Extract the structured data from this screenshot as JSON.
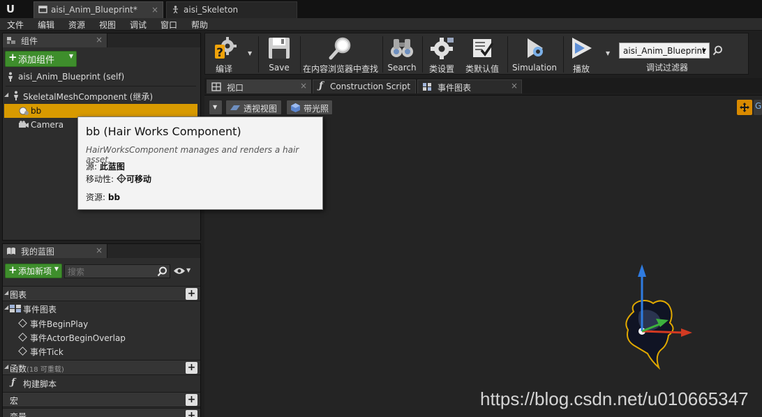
{
  "titlebar": {
    "logo": "U",
    "tabs": [
      {
        "label": "aisi_Anim_Blueprint*",
        "close": "×"
      },
      {
        "label": "aisi_Skeleton",
        "close": ""
      }
    ]
  },
  "menu": [
    "文件",
    "编辑",
    "资源",
    "视图",
    "调试",
    "窗口",
    "帮助"
  ],
  "components_panel": {
    "tab_label": "组件",
    "tab_close": "×",
    "add_button": "添加组件",
    "add_plus": "+",
    "self_item": "aisi_Anim_Blueprint (self)",
    "root_item": "SkeletalMeshComponent (继承)",
    "children": [
      "bb",
      "Camera"
    ]
  },
  "tooltip": {
    "title": "bb (Hair Works Component)",
    "description": "HairWorksComponent manages and renders a hair asset.",
    "source_label": "源:",
    "source_value": "此蓝图",
    "mobility_label": "移动性:",
    "mobility_value": "可移动",
    "asset_label": "资源:",
    "asset_value": "bb"
  },
  "myblueprint_panel": {
    "tab_label": "我的蓝图",
    "tab_close": "×",
    "add_button": "添加新项",
    "add_plus": "+",
    "search_placeholder": "搜索",
    "sections": {
      "graphs": "图表",
      "event_graph": "事件图表",
      "events": [
        "事件BeginPlay",
        "事件ActorBeginOverlap",
        "事件Tick"
      ],
      "functions": "函数",
      "functions_count": "(18 可重载)",
      "construction": "构建脚本",
      "macros": "宏",
      "variables": "变量"
    },
    "add_symbol": "+"
  },
  "toolbar": {
    "buttons": [
      "编译",
      "Save",
      "在内容浏览器中查找",
      "Search",
      "类设置",
      "类默认值",
      "Simulation",
      "播放"
    ],
    "debug_filter_value": "aisi_Anim_Blueprint",
    "debug_filter_label": "调试过滤器"
  },
  "editor_tabs": [
    {
      "label": "视口",
      "close": "×"
    },
    {
      "label": "Construction Script",
      "close": "×"
    },
    {
      "label": "事件图表",
      "close": "×"
    }
  ],
  "viewport": {
    "perspective_label": "透视视图",
    "lit_label": "带光照"
  },
  "watermark": "https://blog.csdn.net/u010665347",
  "colors": {
    "selection": "#d89a00",
    "green_button": "#3e8e2c",
    "gizmo_z": "#2f7be0",
    "gizmo_y": "#3cb13c",
    "gizmo_x": "#d23a22"
  }
}
